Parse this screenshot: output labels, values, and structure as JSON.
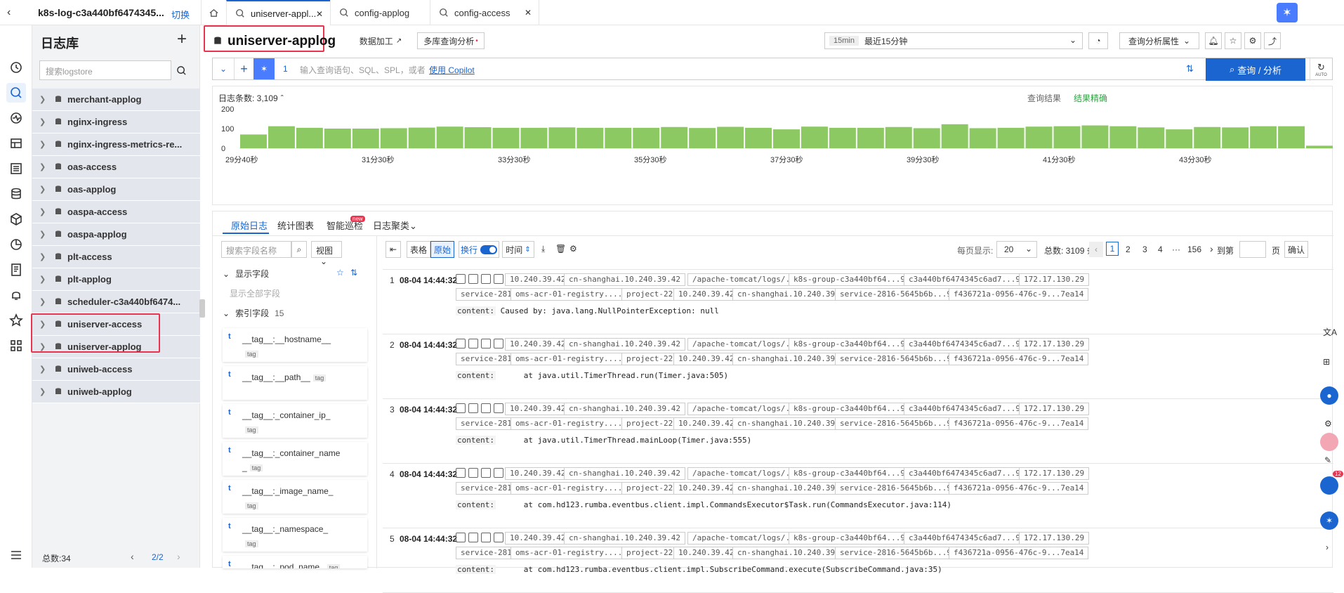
{
  "top": {
    "project": "k8s-log-c3a440bf6474345...",
    "switch_label": "切换",
    "tabs": [
      {
        "label": "uniserver-appl...",
        "active": true
      },
      {
        "label": "config-applog",
        "active": false
      },
      {
        "label": "config-access",
        "active": false
      }
    ]
  },
  "sidebar": {
    "title": "日志库",
    "search_placeholder": "搜索logstore",
    "items": [
      "merchant-applog",
      "nginx-ingress",
      "nginx-ingress-metrics-re...",
      "oas-access",
      "oas-applog",
      "oaspa-access",
      "oaspa-applog",
      "plt-access",
      "plt-applog",
      "scheduler-c3a440bf6474...",
      "uniserver-access",
      "uniserver-applog",
      "uniweb-access",
      "uniweb-applog"
    ],
    "total": "总数:34",
    "page": "2/2"
  },
  "header": {
    "title": "uniserver-applog",
    "process_btn": "数据加工",
    "multi_btn": "多库查询分析",
    "time_badge": "15min",
    "time_label": "最近15分钟",
    "analysis_attr": "查询分析属性"
  },
  "query": {
    "line_no": "1",
    "placeholder": "输入查询语句、SQL、SPL，或者",
    "copilot_link": "使用 Copilot",
    "submit": "查询 / 分析",
    "auto": "AUTO"
  },
  "histogram": {
    "count_label": "日志条数: 3,109",
    "result_label": "查询结果",
    "result_status": "结果精确",
    "colors": {
      "bar": "#8cc963",
      "accent": "#1b65d1",
      "ok": "#2ba640"
    }
  },
  "chart_data": {
    "type": "bar",
    "ylim": [
      0,
      200
    ],
    "yticks": [
      "200",
      "100",
      "0"
    ],
    "xticks": [
      "29分40秒",
      "31分30秒",
      "33分30秒",
      "35分30秒",
      "37分30秒",
      "39分30秒",
      "41分30秒",
      "43分30秒"
    ],
    "values": [
      70,
      112,
      104,
      100,
      100,
      102,
      105,
      110,
      107,
      104,
      104,
      106,
      104,
      104,
      104,
      108,
      103,
      109,
      104,
      96,
      110,
      104,
      104,
      108,
      102,
      122,
      102,
      104,
      110,
      112,
      116,
      112,
      106,
      96,
      108,
      106,
      112,
      112,
      13
    ]
  },
  "tabs2": {
    "raw": "原始日志",
    "stats": "统计图表",
    "inspect": "智能巡检",
    "new": "new",
    "cluster": "日志聚类"
  },
  "fields": {
    "search_placeholder": "搜索字段名称",
    "view": "视图",
    "shown": "显示字段",
    "show_all": "显示全部字段",
    "indexed": "索引字段",
    "indexed_count": "15",
    "items": [
      {
        "t": "t",
        "name": "__tag__:__hostname__",
        "tag": "tag"
      },
      {
        "t": "t",
        "name": "__tag__:__path__",
        "tag": "tag"
      },
      {
        "t": "t",
        "name": "__tag__:_container_ip_",
        "tag": "tag"
      },
      {
        "t": "t",
        "name": "__tag__:_container_name_",
        "tag": "tag"
      },
      {
        "t": "t",
        "name": "__tag__:_image_name_",
        "tag": "tag"
      },
      {
        "t": "t",
        "name": "__tag__:_namespace_",
        "tag": "tag"
      },
      {
        "t": "t",
        "name": "__tag__:_pod_name_",
        "tag": "tag"
      }
    ]
  },
  "logtoolbar": {
    "table": "表格",
    "raw": "原始",
    "wrap": "换行",
    "time": "时间",
    "per_page_label": "每页显示:",
    "per_page": "20",
    "total": "总数: 3109 条",
    "pages": [
      "1",
      "2",
      "3",
      "4",
      "···",
      "156"
    ],
    "goto": "到第",
    "page_unit": "页",
    "confirm": "确认"
  },
  "logs": [
    {
      "n": "1",
      "time": "08-04 14:44:32",
      "chips1": [
        "10.240.39.42",
        "cn-shanghai.10.240.39.42",
        "/apache-tomcat/logs/...r.log",
        "k8s-group-c3a440bf64...98450",
        "c3a440bf6474345c6ad7...98450",
        "172.17.130.29"
      ],
      "chips2": [
        "service-2816",
        "oms-acr-01-registry.....25.4",
        "project-227",
        "10.240.39.42",
        "cn-shanghai.10.240.39.42",
        "service-2816-5645b6b...94zkk",
        "f436721a-0956-476c-9...7ea14"
      ],
      "key": "content:",
      "value": "Caused by: java.lang.NullPointerException: null"
    },
    {
      "n": "2",
      "time": "08-04 14:44:32",
      "chips1": [
        "10.240.39.42",
        "cn-shanghai.10.240.39.42",
        "/apache-tomcat/logs/...r.log",
        "k8s-group-c3a440bf64...98450",
        "c3a440bf6474345c6ad7...98450",
        "172.17.130.29"
      ],
      "chips2": [
        "service-2816",
        "oms-acr-01-registry.....25.4",
        "project-227",
        "10.240.39.42",
        "cn-shanghai.10.240.39.42",
        "service-2816-5645b6b...94zkk",
        "f436721a-0956-476c-9...7ea14"
      ],
      "key": "content:",
      "value": "     at java.util.TimerThread.run(Timer.java:505)"
    },
    {
      "n": "3",
      "time": "08-04 14:44:32",
      "chips1": [
        "10.240.39.42",
        "cn-shanghai.10.240.39.42",
        "/apache-tomcat/logs/...r.log",
        "k8s-group-c3a440bf64...98450",
        "c3a440bf6474345c6ad7...98450",
        "172.17.130.29"
      ],
      "chips2": [
        "service-2816",
        "oms-acr-01-registry.....25.4",
        "project-227",
        "10.240.39.42",
        "cn-shanghai.10.240.39.42",
        "service-2816-5645b6b...94zkk",
        "f436721a-0956-476c-9...7ea14"
      ],
      "key": "content:",
      "value": "     at java.util.TimerThread.mainLoop(Timer.java:555)"
    },
    {
      "n": "4",
      "time": "08-04 14:44:32",
      "chips1": [
        "10.240.39.42",
        "cn-shanghai.10.240.39.42",
        "/apache-tomcat/logs/...r.log",
        "k8s-group-c3a440bf64...98450",
        "c3a440bf6474345c6ad7...98450",
        "172.17.130.29"
      ],
      "chips2": [
        "service-2816",
        "oms-acr-01-registry.....25.4",
        "project-227",
        "10.240.39.42",
        "cn-shanghai.10.240.39.42",
        "service-2816-5645b6b...94zkk",
        "f436721a-0956-476c-9...7ea14"
      ],
      "key": "content:",
      "value": "     at com.hd123.rumba.eventbus.client.impl.CommandsExecutor$Task.run(CommandsExecutor.java:114)"
    },
    {
      "n": "5",
      "time": "08-04 14:44:32",
      "chips1": [
        "10.240.39.42",
        "cn-shanghai.10.240.39.42",
        "/apache-tomcat/logs/...r.log",
        "k8s-group-c3a440bf64...98450",
        "c3a440bf6474345c6ad7...98450",
        "172.17.130.29"
      ],
      "chips2": [
        "service-2816",
        "oms-acr-01-registry.....25.4",
        "project-227",
        "10.240.39.42",
        "cn-shanghai.10.240.39.42",
        "service-2816-5645b6b...94zkk",
        "f436721a-0956-476c-9...7ea14"
      ],
      "key": "content:",
      "value": "     at com.hd123.rumba.eventbus.client.impl.SubscribeCommand.execute(SubscribeCommand.java:35)"
    }
  ],
  "floating": {
    "badge": "12"
  }
}
